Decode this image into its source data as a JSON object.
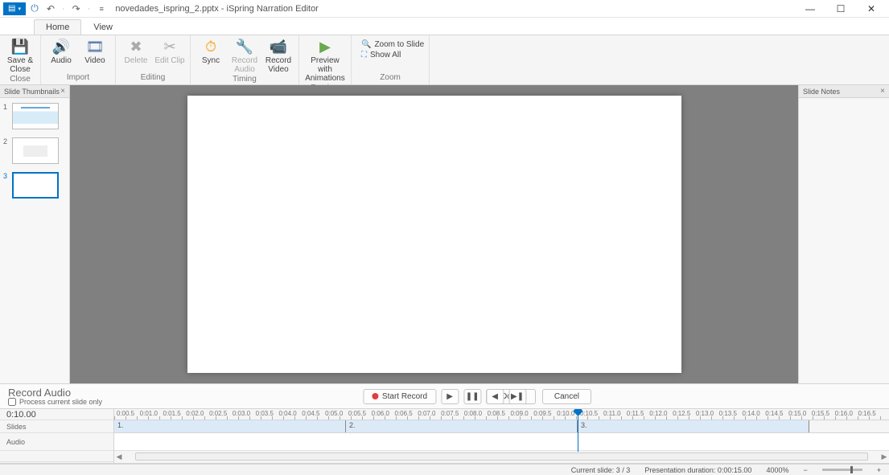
{
  "title": "novedades_ispring_2.pptx - iSpring Narration Editor",
  "tabs": {
    "home": "Home",
    "view": "View"
  },
  "ribbon": {
    "save_close": "Save & Close",
    "close_group": "Close",
    "audio": "Audio",
    "video": "Video",
    "import_group": "Import",
    "delete": "Delete",
    "edit_clip": "Edit Clip",
    "editing_group": "Editing",
    "sync": "Sync",
    "record_audio": "Record Audio",
    "record_video": "Record Video",
    "timing_group": "Timing",
    "preview_anim": "Preview with Animations",
    "preview_group": "Preview",
    "zoom_to_slide": "Zoom to Slide",
    "show_all": "Show All",
    "zoom_group": "Zoom"
  },
  "panels": {
    "thumbs": "Slide Thumbnails",
    "notes": "Slide Notes"
  },
  "record": {
    "title": "Record Audio",
    "process_only": "Process current slide only",
    "start": "Start Record",
    "done": "Done",
    "cancel": "Cancel"
  },
  "timeline": {
    "time": "0:10.00",
    "slides_label": "Slides",
    "audio_label": "Audio",
    "ruler": [
      "0:00.5",
      "0:01.0",
      "0:01.5",
      "0:02.0",
      "0:02.5",
      "0:03.0",
      "0:03.5",
      "0:04.0",
      "0:04.5",
      "0:05.0",
      "0:05.5",
      "0:06.0",
      "0:06.5",
      "0:07.0",
      "0:07.5",
      "0:08.0",
      "0:08.5",
      "0:09.0",
      "0:09.5",
      "0:10.0",
      "0:10.5",
      "0:11.0",
      "0:11.5",
      "0:12.0",
      "0:12.5",
      "0:13.0",
      "0:13.5",
      "0:14.0",
      "0:14.5",
      "0:15.0",
      "0:15.5",
      "0:16.0",
      "0:16.5"
    ],
    "segs": [
      "1.",
      "2.",
      "3."
    ]
  },
  "status": {
    "current": "Current slide: 3 / 3",
    "duration": "Presentation duration: 0:00:15.00",
    "zoom": "4000%"
  },
  "slides": {
    "n1": "1",
    "n2": "2",
    "n3": "3"
  }
}
